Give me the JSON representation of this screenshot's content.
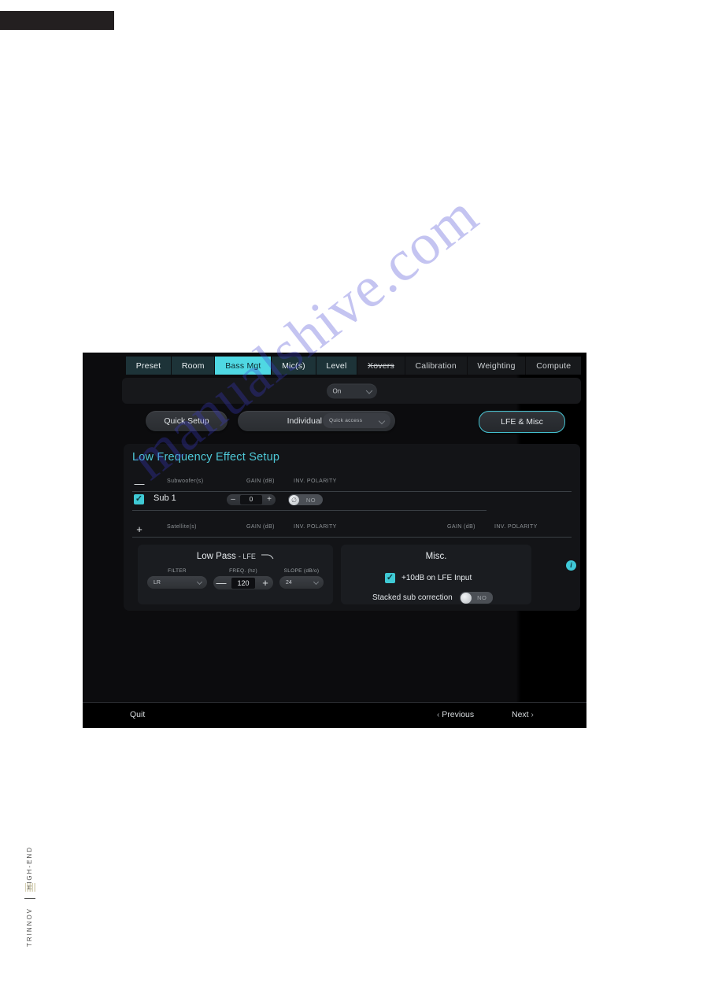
{
  "window": {
    "top_bar_label": ""
  },
  "watermark": {
    "text": "manualshive.com"
  },
  "tabs": [
    {
      "label": "Preset",
      "state": "normal"
    },
    {
      "label": "Room",
      "state": "normal"
    },
    {
      "label": "Bass Mgt",
      "state": "active"
    },
    {
      "label": "Mic(s)",
      "state": "normal"
    },
    {
      "label": "Level",
      "state": "normal"
    },
    {
      "label": "Xovers",
      "state": "disabled"
    },
    {
      "label": "Calibration",
      "state": "normal"
    },
    {
      "label": "Weighting",
      "state": "normal"
    },
    {
      "label": "Compute",
      "state": "normal"
    }
  ],
  "mode_bar": {
    "select_value": "On"
  },
  "setup_buttons": {
    "quick_setup": "Quick Setup",
    "individual_setup": "Individual Setup",
    "quick_access": "Quick access",
    "lfe_misc": "LFE & Misc"
  },
  "panel": {
    "title": "Low Frequency Effect Setup",
    "subwoofer_header": {
      "icon": "minus-icon",
      "name": "Subwoofer(s)",
      "gain": "GAIN (dB)",
      "polarity": "INV. POLARITY"
    },
    "subwoofer_rows": [
      {
        "checked": true,
        "name": "Sub 1",
        "gain_value": "0",
        "minus": "–",
        "plus": "+",
        "polarity_value": "NO"
      }
    ],
    "satellite_header": {
      "icon": "plus-cursor-icon",
      "name": "Satellite(s)",
      "gain": "GAIN (dB)",
      "polarity": "INV. POLARITY",
      "gain2": "GAIN (dB)",
      "polarity2": "INV. POLARITY"
    }
  },
  "low_pass_card": {
    "title": "Low Pass",
    "subtitle": "- LFE",
    "filter_label": "FILTER",
    "filter_value": "LR",
    "freq_label": "FREQ. (hz)",
    "freq_value": "120",
    "freq_minus": "—",
    "freq_plus": "+",
    "slope_label": "SLOPE (dB/o)",
    "slope_value": "24"
  },
  "misc_card": {
    "title": "Misc.",
    "lfe_input_checked": true,
    "lfe_input_label": "+10dB on LFE Input",
    "stacked_label": "Stacked sub correction",
    "stacked_value": "NO"
  },
  "info_icon": {
    "glyph": "i"
  },
  "bottom_bar": {
    "quit": "Quit",
    "previous": "Previous",
    "next": "Next",
    "prev_arrow": "‹",
    "next_arrow": "›"
  },
  "brand": {
    "top_text": "HIGH-END",
    "bottom_text": "TRINNOV"
  },
  "colors": {
    "accent_cyan": "#4fd8e3",
    "title_cyan": "#4ec9d8",
    "tab_bg": "#1d3338",
    "panel_bg": "#131417",
    "app_bg": "#0c0c0e",
    "watermark_blue": "#3c3cd2"
  }
}
